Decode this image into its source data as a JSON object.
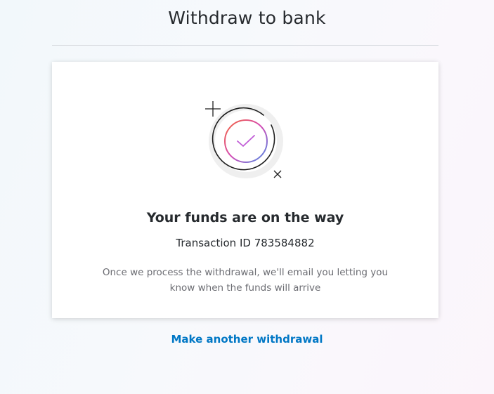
{
  "header": {
    "title": "Withdraw to bank"
  },
  "card": {
    "icon": "check-circle-icon",
    "heading": "Your funds are on the way",
    "transaction_label": "Transaction ID",
    "transaction_id": "783584882",
    "message": "Once we process the withdrawal, we'll email you letting you know when the funds will arrive"
  },
  "actions": {
    "another_withdrawal": "Make another withdrawal"
  },
  "colors": {
    "link": "#0077c5",
    "gradient_start": "#f5673a",
    "gradient_mid": "#d44bb6",
    "gradient_end": "#4a8fe7"
  }
}
